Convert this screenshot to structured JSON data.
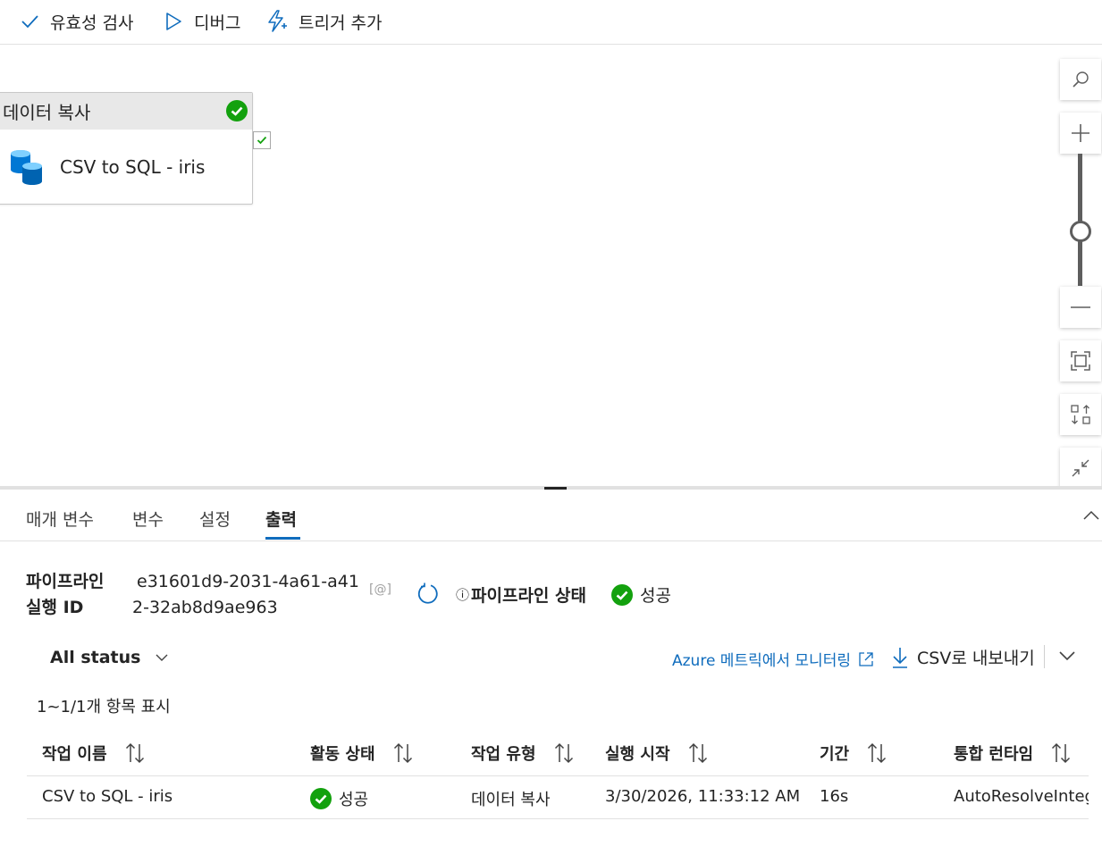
{
  "toolbar": {
    "validate_label": "유효성 검사",
    "debug_label": "디버그",
    "trigger_label": "트리거 추가"
  },
  "canvas": {
    "activity": {
      "type_label": "데이터 복사",
      "name": "CSV to SQL - iris",
      "status_icon": "check-circle-icon"
    },
    "controls": [
      "search-icon",
      "zoom-in-icon",
      "zoom-out-icon",
      "fit-to-screen-icon",
      "auto-align-icon",
      "collapse-icon"
    ]
  },
  "tabs": [
    {
      "label": "매개 변수"
    },
    {
      "label": "변수"
    },
    {
      "label": "설정"
    },
    {
      "label": "출력",
      "active": true
    }
  ],
  "run": {
    "label": "파이프라인 실행 ID",
    "id_line1": "e31601d9-2031-4a61-a41",
    "id_line2": "2-32ab8d9ae963",
    "copy_text": "[@]",
    "status_label": "파이프라인 상태",
    "info_glyph": "ⓘ",
    "status_value": "성공"
  },
  "filter": {
    "status_filter": "All status"
  },
  "actions": {
    "monitor_link": "Azure 메트릭에서 모니터링",
    "export_label": "CSV로 내보내기"
  },
  "items_count": "1~1/1개 항목 표시",
  "table": {
    "columns": [
      "작업 이름",
      "활동 상태",
      "작업 유형",
      "실행 시작",
      "기간",
      "통합 런타임"
    ],
    "rows": [
      {
        "name": "CSV to SQL - iris",
        "status": "성공",
        "type": "데이터 복사",
        "start": "3/30/2026, 11:33:12 AM",
        "duration": "16s",
        "runtime": "AutoResolveInteg"
      }
    ]
  },
  "colors": {
    "accent": "#0f6cbd",
    "success": "#13a10e",
    "db_icon": "#0078d4"
  }
}
